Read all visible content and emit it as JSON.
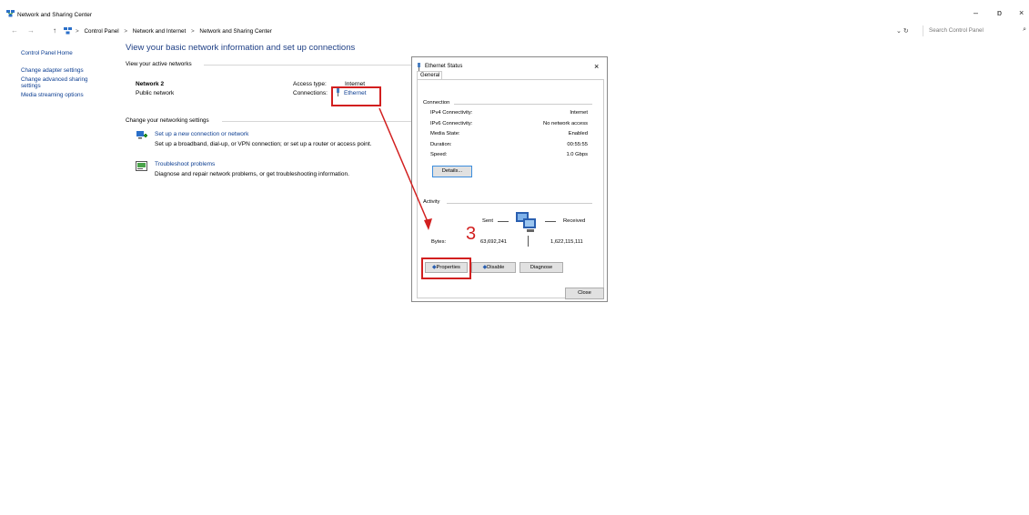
{
  "window": {
    "title": "Network and Sharing Center",
    "minimize_glyph": "–",
    "maximize_glyph": "ɒ",
    "close_glyph": "×"
  },
  "address": {
    "back_glyph": "←",
    "forward_glyph": "→",
    "up_glyph": "↑",
    "breadcrumb": [
      "Control Panel",
      "Network and Internet",
      "Network and Sharing Center"
    ],
    "separator": ">",
    "dropdown_glyph": "⌄",
    "refresh_glyph": "↻",
    "search_placeholder": "Search Control Panel",
    "search_glyph": "⌕"
  },
  "sidebar": {
    "items": [
      {
        "label": "Control Panel Home"
      },
      {
        "label": "Change adapter settings"
      },
      {
        "label": "Change advanced sharing settings"
      },
      {
        "label": "Media streaming options"
      }
    ]
  },
  "main": {
    "heading": "View your basic network information and set up connections",
    "active_networks_label": "View your active networks",
    "network_name": "Network 2",
    "network_type": "Public network",
    "access_type_label": "Access type:",
    "access_type_value": "Internet",
    "connections_label": "Connections:",
    "connection_link": "Ethernet",
    "change_settings_label": "Change your networking settings",
    "tasks": [
      {
        "title": "Set up a new connection or network",
        "desc": "Set up a broadband, dial-up, or VPN connection; or set up a router or access point."
      },
      {
        "title": "Troubleshoot problems",
        "desc": "Diagnose and repair network problems, or get troubleshooting information."
      }
    ]
  },
  "dialog": {
    "title": "Ethernet Status",
    "close_glyph": "×",
    "tab": "General",
    "connection_group": "Connection",
    "rows": [
      {
        "label": "IPv4 Connectivity:",
        "value": "Internet"
      },
      {
        "label": "IPv6 Connectivity:",
        "value": "No network access"
      },
      {
        "label": "Media State:",
        "value": "Enabled"
      },
      {
        "label": "Duration:",
        "value": "00:55:55"
      },
      {
        "label": "Speed:",
        "value": "1.0 Gbps"
      }
    ],
    "details_button": "Details...",
    "activity_group": "Activity",
    "sent_label": "Sent",
    "received_label": "Received",
    "bytes_label": "Bytes:",
    "bytes_sent": "63,692,241",
    "bytes_received": "1,622,115,111",
    "properties_button": "Properties",
    "disable_button": "Disable",
    "diagnose_button": "Diagnose",
    "close_button": "Close"
  },
  "annotation": {
    "step_number": "3",
    "color": "#d21f1f"
  }
}
